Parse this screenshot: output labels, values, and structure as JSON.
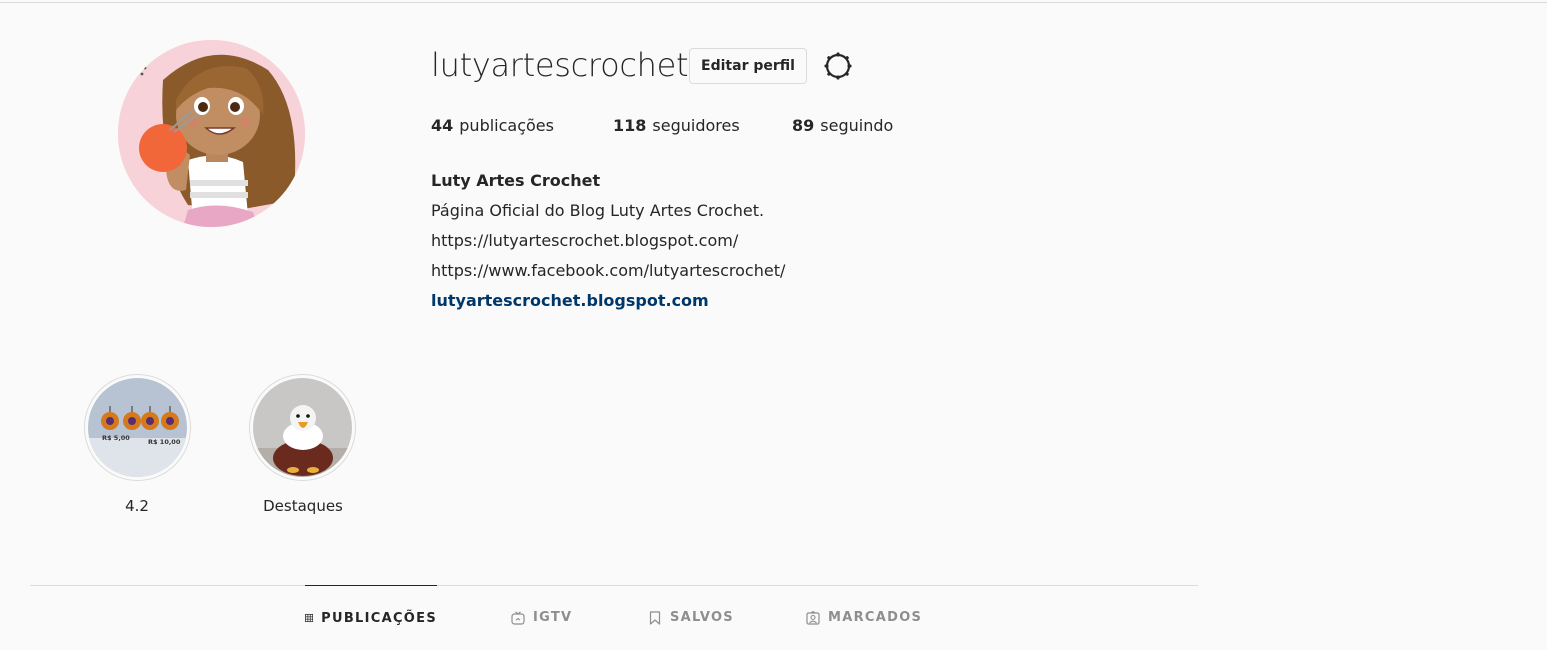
{
  "profile": {
    "username": "lutyartescrochet",
    "edit_label": "Editar perfil",
    "stats": {
      "posts_count": "44",
      "posts_label": "publicações",
      "followers_count": "118",
      "followers_label": "seguidores",
      "following_count": "89",
      "following_label": "seguindo"
    },
    "bio": {
      "full_name": "Luty Artes Crochet",
      "line1": "Página Oficial do Blog Luty Artes Crochet.",
      "line2": "https://lutyartescrochet.blogspot.com/",
      "line3": "https://www.facebook.com/lutyartescrochet/",
      "link": "lutyartescrochet.blogspot.com"
    }
  },
  "highlights": [
    {
      "label": "4.2",
      "price_left": "R$ 5,00",
      "price_right": "R$ 10,00"
    },
    {
      "label": "Destaques"
    }
  ],
  "tabs": [
    {
      "label": "PUBLICAÇÕES",
      "icon": "grid-icon",
      "active": true
    },
    {
      "label": "IGTV",
      "icon": "tv-icon",
      "active": false
    },
    {
      "label": "SALVOS",
      "icon": "bookmark-icon",
      "active": false
    },
    {
      "label": "MARCADOS",
      "icon": "tagged-user-icon",
      "active": false
    }
  ],
  "colors": {
    "background": "#fafafa",
    "text": "#262626",
    "muted": "#8e8e8e",
    "link": "#00376b",
    "border": "#dbdbdb"
  }
}
